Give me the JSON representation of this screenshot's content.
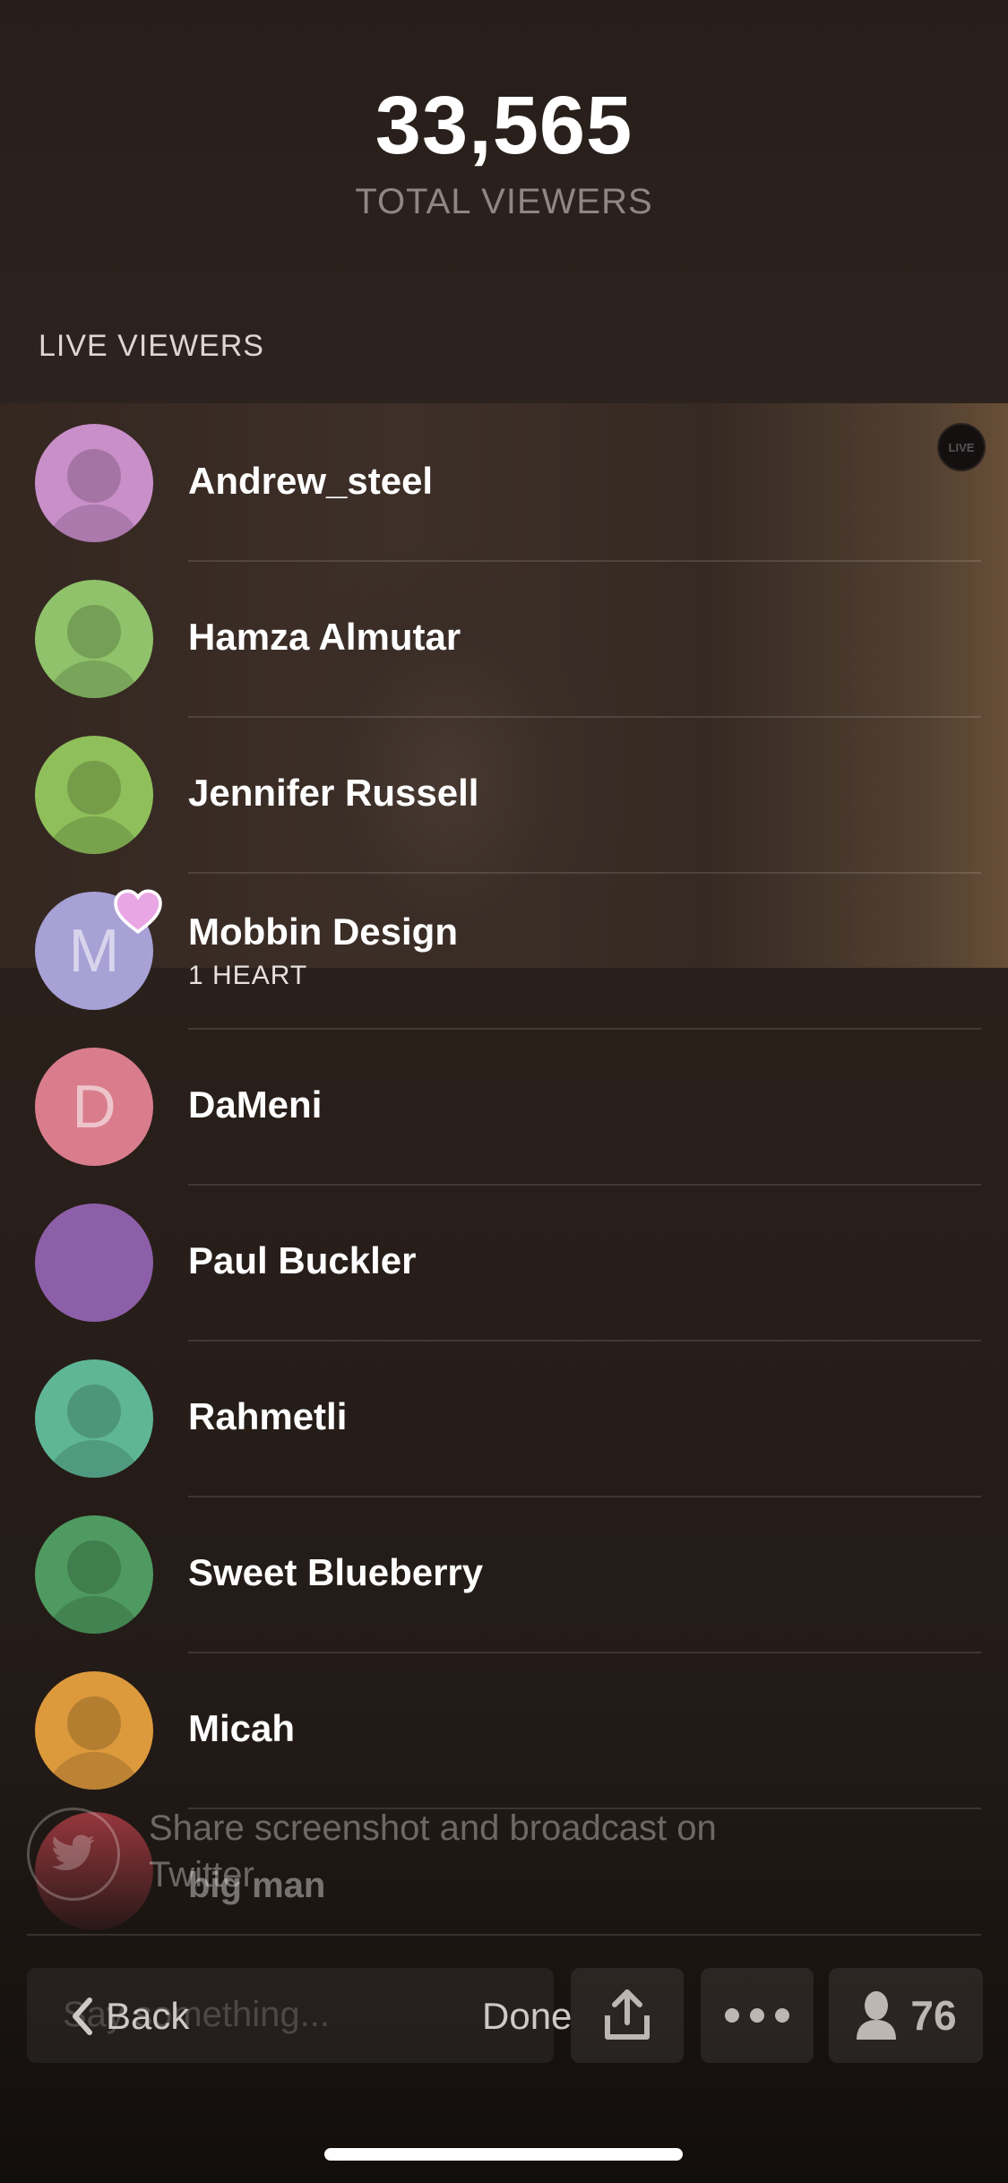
{
  "stats": {
    "total_viewers_count": "33,565",
    "total_viewers_label": "TOTAL VIEWERS",
    "section_title": "LIVE VIEWERS"
  },
  "video": {
    "badge_text": "LIVE"
  },
  "viewers": [
    {
      "name": "Andrew_steel",
      "avatar_color": "#c98fc9",
      "avatar_type": "photo"
    },
    {
      "name": "Hamza Almutar",
      "avatar_color": "#8fc26a",
      "avatar_type": "photo"
    },
    {
      "name": "Jennifer Russell",
      "avatar_color": "#8fbf5a",
      "avatar_type": "photo"
    },
    {
      "name": "Mobbin Design",
      "sub": "1 HEART",
      "initial": "M",
      "avatar_color": "#a7a1d6",
      "avatar_type": "initial",
      "heart_color": "#e9a6e4"
    },
    {
      "name": "DaMeni",
      "initial": "D",
      "avatar_color": "#d97d8c",
      "avatar_type": "initial"
    },
    {
      "name": "Paul Buckler",
      "avatar_color": "#8d5fa8",
      "avatar_type": "plain"
    },
    {
      "name": "Rahmetli",
      "avatar_color": "#5fb697",
      "avatar_type": "photo"
    },
    {
      "name": "Sweet Blueberry",
      "avatar_color": "#4f9a60",
      "avatar_type": "photo"
    },
    {
      "name": "Micah",
      "avatar_color": "#dc9a3c",
      "avatar_type": "photo"
    }
  ],
  "share_hint": {
    "text": "Share screenshot and broadcast on Twitter",
    "faded_name": "big man"
  },
  "toolbar": {
    "comment_placeholder": "Say something...",
    "back_label": "Back",
    "done_label": "Done",
    "viewer_count": "76"
  }
}
